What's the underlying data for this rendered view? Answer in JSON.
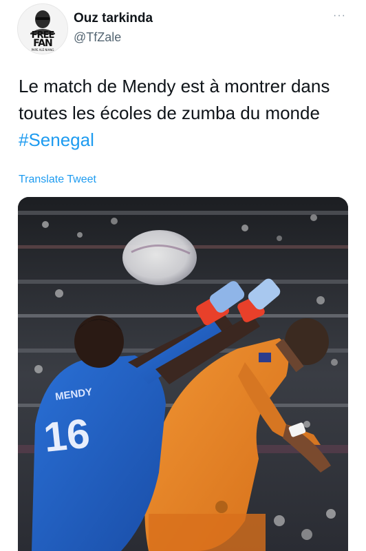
{
  "author": {
    "display_name": "Ouz tarkinda",
    "handle": "@TfZale",
    "avatar_text": {
      "line1": "FREE",
      "line2": "FAN",
      "line3": "PAPE ALÉ NIANG"
    }
  },
  "menu": {
    "more_label": "···",
    "icon": "more-horizontal-icon"
  },
  "tweet": {
    "text_before_hashtag": "Le match de Mendy est à montrer dans toutes les écoles de zumba du monde ",
    "hashtag": "#Senegal",
    "translate_label": "Translate Tweet"
  },
  "media": {
    "description": "",
    "jersey_name": "MENDY",
    "jersey_number": "16",
    "colors": {
      "blue_kit": "#1f5fbf",
      "orange_kit": "#e8821c",
      "link": "#1d9bf0"
    }
  }
}
